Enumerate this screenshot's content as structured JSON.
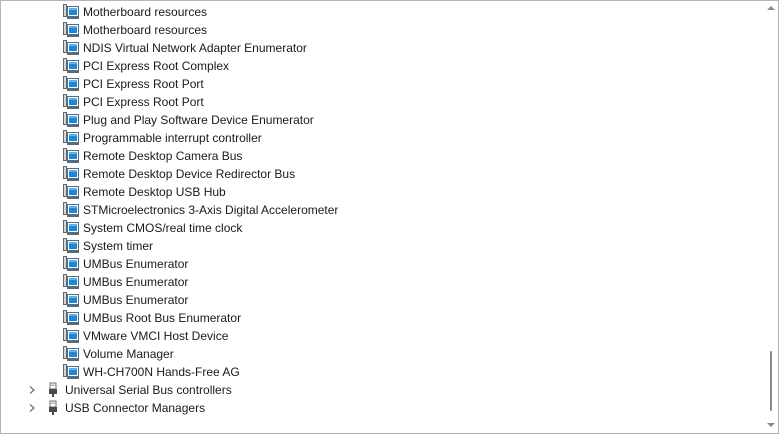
{
  "device_tree": {
    "system_devices_children": [
      {
        "label": "Motherboard resources"
      },
      {
        "label": "Motherboard resources"
      },
      {
        "label": "NDIS Virtual Network Adapter Enumerator"
      },
      {
        "label": "PCI Express Root Complex"
      },
      {
        "label": "PCI Express Root Port"
      },
      {
        "label": "PCI Express Root Port"
      },
      {
        "label": "Plug and Play Software Device Enumerator"
      },
      {
        "label": "Programmable interrupt controller"
      },
      {
        "label": "Remote Desktop Camera Bus"
      },
      {
        "label": "Remote Desktop Device Redirector Bus"
      },
      {
        "label": "Remote Desktop USB Hub"
      },
      {
        "label": "STMicroelectronics 3-Axis Digital Accelerometer"
      },
      {
        "label": "System CMOS/real time clock"
      },
      {
        "label": "System timer"
      },
      {
        "label": "UMBus Enumerator"
      },
      {
        "label": "UMBus Enumerator"
      },
      {
        "label": "UMBus Enumerator"
      },
      {
        "label": "UMBus Root Bus Enumerator"
      },
      {
        "label": "VMware VMCI Host Device"
      },
      {
        "label": "Volume Manager"
      },
      {
        "label": "WH-CH700N Hands-Free AG"
      }
    ],
    "categories": [
      {
        "label": "Universal Serial Bus controllers",
        "icon": "usb-icon",
        "expanded": false
      },
      {
        "label": "USB Connector Managers",
        "icon": "usb-icon",
        "expanded": false
      }
    ]
  },
  "icons": {
    "device": "system-device-icon",
    "collapsed": "chevron-right-icon"
  },
  "colors": {
    "icon_blue": "#1e88d8",
    "icon_frame": "#5a6b7a",
    "text": "#1a1a1a"
  }
}
